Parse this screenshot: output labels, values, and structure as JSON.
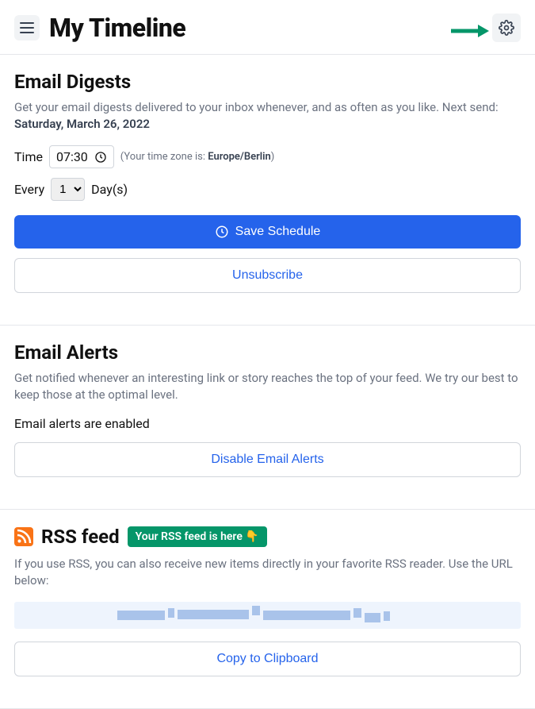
{
  "header": {
    "title": "My Timeline"
  },
  "digests": {
    "heading": "Email Digests",
    "desc_prefix": "Get your email digests delivered to your inbox whenever, and as often as you like. Next send: ",
    "next_send": "Saturday, March 26, 2022",
    "time_label": "Time",
    "time_value": "07:30",
    "tz_prefix": "(Your time zone is: ",
    "tz_value": "Europe/Berlin",
    "tz_suffix": ")",
    "every_label": "Every",
    "every_value": "1",
    "every_unit": "Day(s)",
    "save_label": "Save Schedule",
    "unsubscribe_label": "Unsubscribe"
  },
  "alerts": {
    "heading": "Email Alerts",
    "desc": "Get notified whenever an interesting link or story reaches the top of your feed. We try our best to keep those at the optimal level.",
    "status": "Email alerts are enabled",
    "disable_label": "Disable Email Alerts"
  },
  "rss": {
    "heading": "RSS feed",
    "badge": "Your RSS feed is here 👇",
    "desc": "If you use RSS, you can also receive new items directly in your favorite RSS reader. Use the URL below:",
    "copy_label": "Copy to Clipboard"
  }
}
